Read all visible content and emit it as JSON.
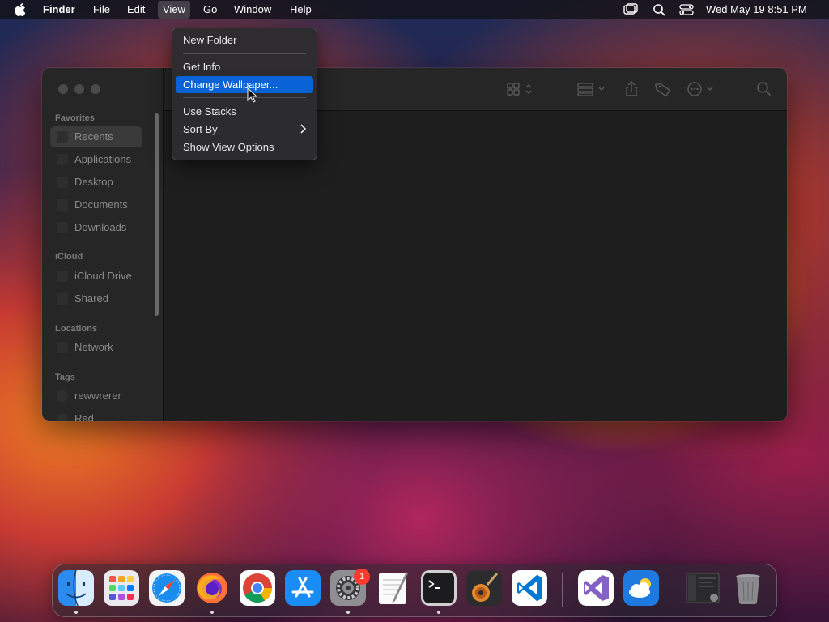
{
  "menubar": {
    "app_name": "Finder",
    "menus": [
      "File",
      "Edit",
      "View",
      "Go",
      "Window",
      "Help"
    ],
    "active_menu": "View",
    "datetime": "Wed May 19  8:51 PM"
  },
  "finder": {
    "sidebar": {
      "sections": [
        "Favorites",
        "iCloud",
        "Locations",
        "Tags"
      ],
      "favorites": [
        "Recents",
        "Applications",
        "Desktop",
        "Documents",
        "Downloads"
      ],
      "icloud": [
        "iCloud Drive",
        "Shared"
      ],
      "locations": [
        "Network"
      ],
      "tags": [
        "rewwrerer",
        "Red"
      ],
      "selected": "Recents"
    }
  },
  "context_menu": {
    "items": [
      "New Folder",
      "Get Info",
      "Change Wallpaper...",
      "Use Stacks",
      "Sort By",
      "Show View Options"
    ],
    "highlighted": "Change Wallpaper..."
  },
  "dock": {
    "apps": [
      "Finder",
      "Launchpad",
      "Safari",
      "Firefox",
      "Chrome",
      "App Store",
      "System Preferences",
      "TextEdit",
      "Terminal",
      "GarageBand",
      "Visual Studio Code",
      "Visual Studio",
      "Weather",
      "Screenshot",
      "Trash"
    ],
    "badge_count": "1"
  },
  "colors": {
    "accent": "#0a63d6",
    "window_bg": "#1f1f1f",
    "sidebar_bg": "#262626"
  }
}
